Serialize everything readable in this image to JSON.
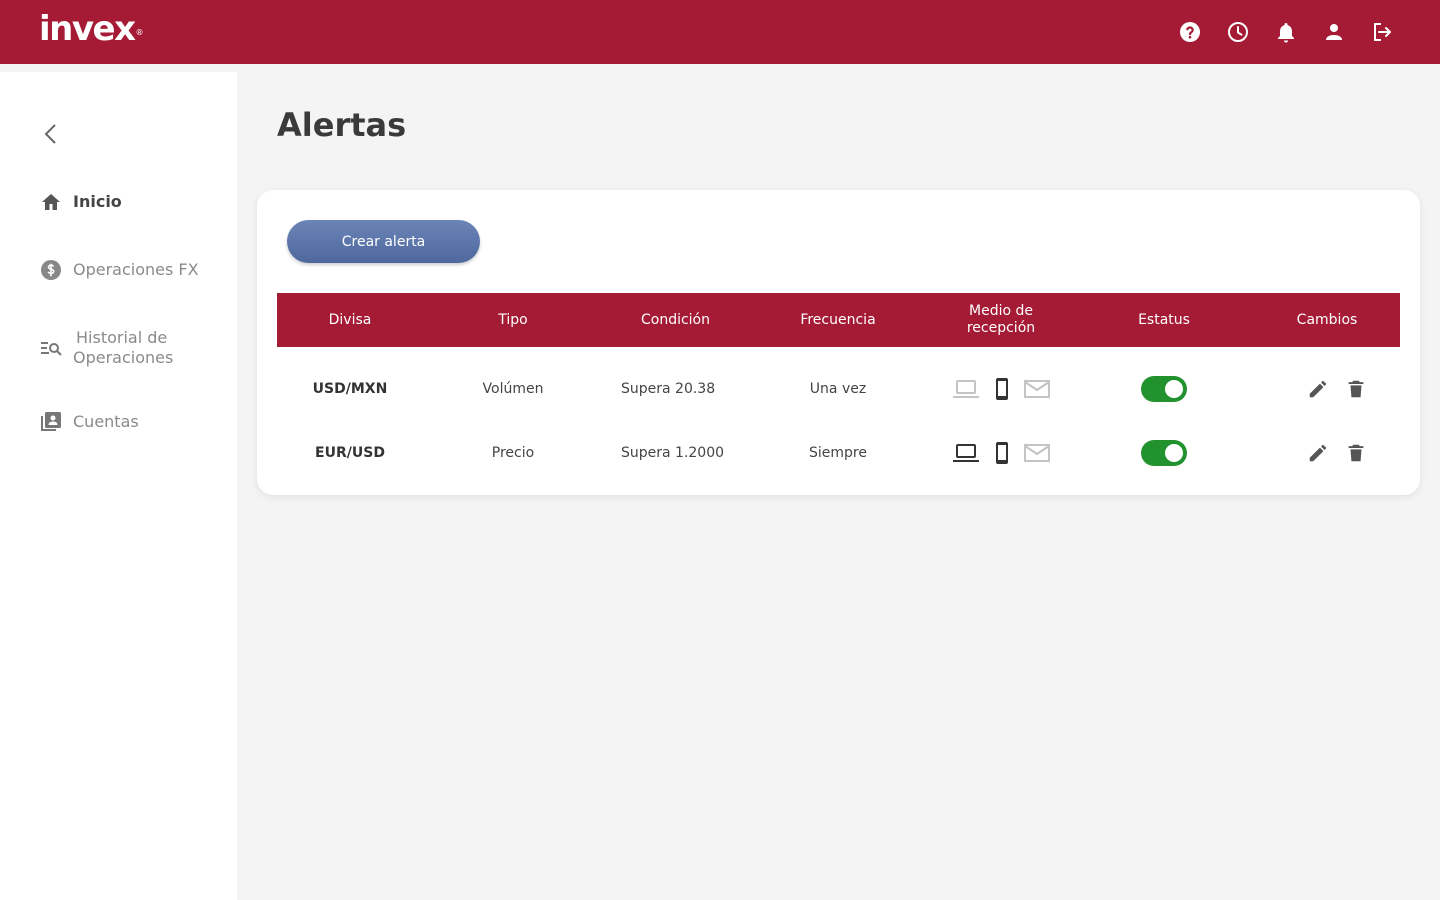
{
  "brand": {
    "logo_text": "invex",
    "logo_mark": "®"
  },
  "topbar": {
    "icons": [
      "help-icon",
      "history-icon",
      "notifications-icon",
      "profile-icon",
      "logout-icon"
    ]
  },
  "sidebar": {
    "items": [
      {
        "label": "Inicio",
        "icon": "home-icon",
        "active": true
      },
      {
        "label": "Operaciones FX",
        "icon": "dollar-coin-icon",
        "active": false
      },
      {
        "label": "Historial de Operaciones",
        "label_line1": "Historial de",
        "label_line2": "Operaciones",
        "icon": "history-search-icon",
        "active": false
      },
      {
        "label": "Cuentas",
        "icon": "accounts-icon",
        "active": false
      }
    ]
  },
  "page": {
    "title": "Alertas"
  },
  "alerts": {
    "create_button": "Crear alerta",
    "columns": [
      "Divisa",
      "Tipo",
      "Condición",
      "Frecuencia",
      "Medio de recepción",
      "Estatus",
      "Cambios"
    ],
    "column_medio_line1": "Medio de",
    "column_medio_line2": "recepción",
    "rows": [
      {
        "divisa": "USD/MXN",
        "tipo": "Volúmen",
        "condicion": "Supera 20.38",
        "frecuencia": "Una vez",
        "medio": {
          "web": false,
          "mobile": true,
          "email": false
        },
        "estatus": true
      },
      {
        "divisa": "EUR/USD",
        "tipo": "Precio",
        "condicion": "Supera 1.2000",
        "frecuencia": "Siempre",
        "medio": {
          "web": true,
          "mobile": true,
          "email": false
        },
        "estatus": true
      }
    ]
  },
  "colors": {
    "brand_red": "#a51b36",
    "button_blue": "#5872a8",
    "toggle_green": "#22922e",
    "active_icon": "#333333",
    "inactive_icon": "#c4c4c4"
  }
}
